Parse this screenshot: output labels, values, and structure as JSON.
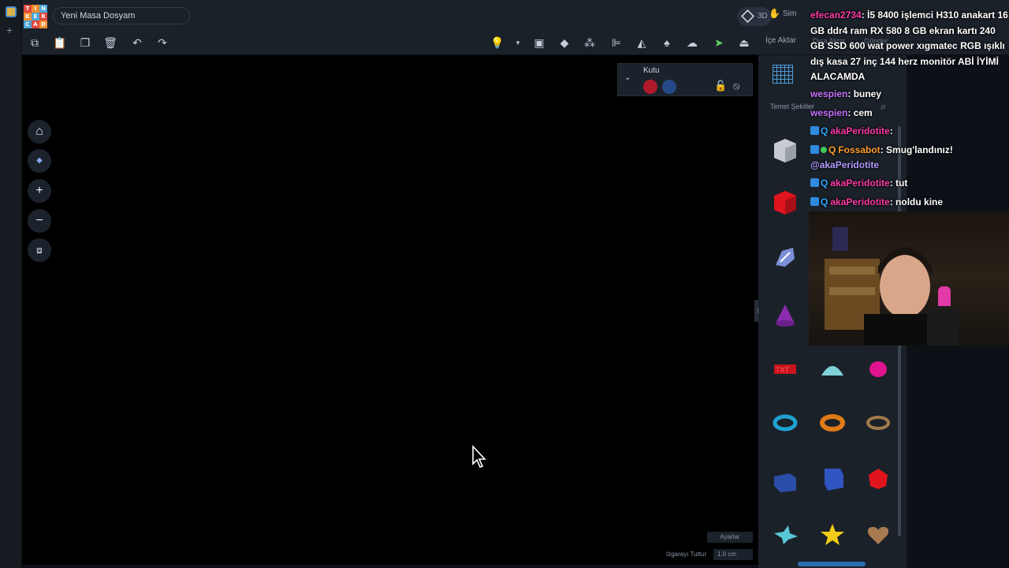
{
  "app": {
    "logo_letters": [
      "T",
      "I",
      "N",
      "K",
      "E",
      "R",
      "C",
      "A",
      "D"
    ],
    "document_name": "Yeni Masa Dosyam",
    "view_toggle_label": "3D",
    "sim_label": "Sim"
  },
  "toolbar": {
    "import_label": "İçe Aktar",
    "export_label": "Dışa Aktar",
    "send_label": "Gönder"
  },
  "inspector": {
    "title": "Kutu",
    "solid_color": "#b0192a",
    "hole_color": "#234a86"
  },
  "library": {
    "category_label": "Temel Şekiller"
  },
  "workplane": {
    "settings_label": "Ayarlar",
    "snap_grid_label": "Izgarayı Tuttur",
    "snap_grid_value": "1.0 cm"
  },
  "chat": {
    "messages": [
      {
        "user": "efecan2734",
        "text": ": İ5 8400 işlemci H310 anakart 16 GB ddr4 ram RX 580 8 GB ekran kartı 240 GB SSD 600 wat power xıgmatec RGB ışıklı dış kasa 27 inç 144 herz monitör ABİ İYİMİ ALACAMDA"
      },
      {
        "user": "wespien",
        "text": ": buney"
      },
      {
        "user": "wespien",
        "text": ": cem"
      },
      {
        "user": "akaPeridotite",
        "text": ":"
      },
      {
        "user": "Fossabot",
        "text": ": Smug'landınız!",
        "mention": "@akaPeridotite"
      },
      {
        "user": "akaPeridotite",
        "text": ": tut"
      },
      {
        "user": "akaPeridotite",
        "text": ": noldu kine"
      }
    ]
  },
  "colors": {
    "background": "#0d1117",
    "panel": "#1b2129",
    "canvas": "#000000",
    "accent": "#2c6fb1"
  }
}
